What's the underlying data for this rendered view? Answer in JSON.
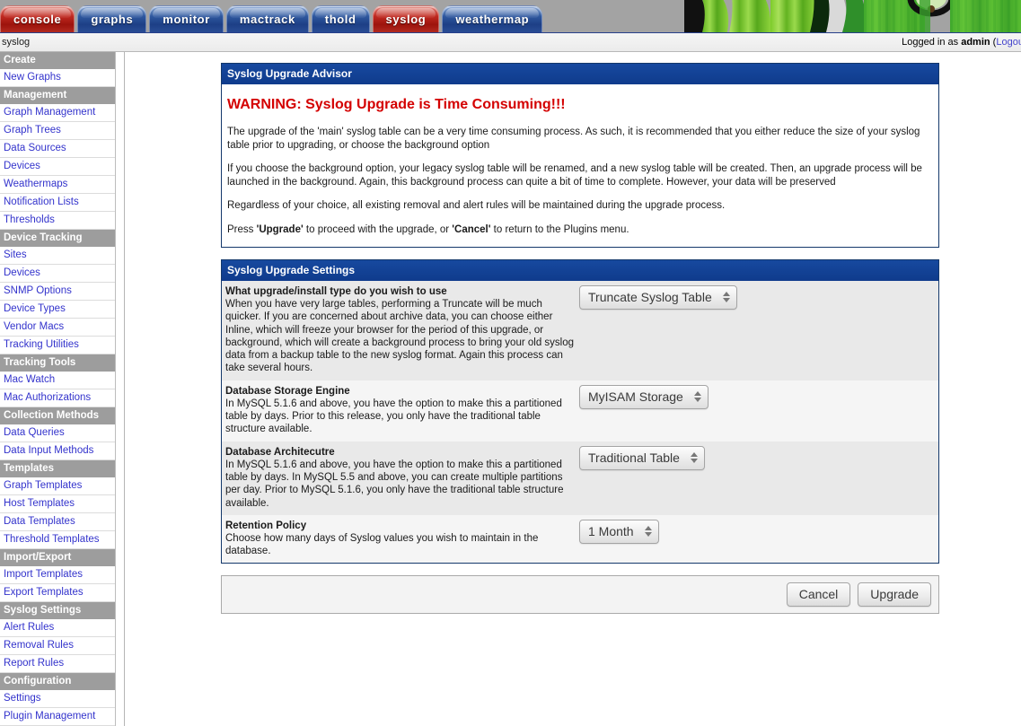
{
  "tabs": [
    {
      "label": "console",
      "state": "red"
    },
    {
      "label": "graphs",
      "state": "blue"
    },
    {
      "label": "monitor",
      "state": "blue"
    },
    {
      "label": "mactrack",
      "state": "blue"
    },
    {
      "label": "thold",
      "state": "blue"
    },
    {
      "label": "syslog",
      "state": "red"
    },
    {
      "label": "weathermap",
      "state": "blue"
    }
  ],
  "topbar": {
    "breadcrumb": "syslog",
    "logged_in_prefix": "Logged in as ",
    "user": "admin",
    "logout_open": " (",
    "logout_label": "Logout"
  },
  "sidebar": {
    "items": [
      {
        "label": "Create",
        "type": "header"
      },
      {
        "label": "New Graphs",
        "type": "link"
      },
      {
        "label": "Management",
        "type": "header"
      },
      {
        "label": "Graph Management",
        "type": "link"
      },
      {
        "label": "Graph Trees",
        "type": "link"
      },
      {
        "label": "Data Sources",
        "type": "link"
      },
      {
        "label": "Devices",
        "type": "link"
      },
      {
        "label": "Weathermaps",
        "type": "link"
      },
      {
        "label": "Notification Lists",
        "type": "link"
      },
      {
        "label": "Thresholds",
        "type": "link"
      },
      {
        "label": "Device Tracking",
        "type": "header"
      },
      {
        "label": "Sites",
        "type": "link"
      },
      {
        "label": "Devices",
        "type": "link"
      },
      {
        "label": "SNMP Options",
        "type": "link"
      },
      {
        "label": "Device Types",
        "type": "link"
      },
      {
        "label": "Vendor Macs",
        "type": "link"
      },
      {
        "label": "Tracking Utilities",
        "type": "link"
      },
      {
        "label": "Tracking Tools",
        "type": "header"
      },
      {
        "label": "Mac Watch",
        "type": "link"
      },
      {
        "label": "Mac Authorizations",
        "type": "link"
      },
      {
        "label": "Collection Methods",
        "type": "header"
      },
      {
        "label": "Data Queries",
        "type": "link"
      },
      {
        "label": "Data Input Methods",
        "type": "link"
      },
      {
        "label": "Templates",
        "type": "header"
      },
      {
        "label": "Graph Templates",
        "type": "link"
      },
      {
        "label": "Host Templates",
        "type": "link"
      },
      {
        "label": "Data Templates",
        "type": "link"
      },
      {
        "label": "Threshold Templates",
        "type": "link"
      },
      {
        "label": "Import/Export",
        "type": "header"
      },
      {
        "label": "Import Templates",
        "type": "link"
      },
      {
        "label": "Export Templates",
        "type": "link"
      },
      {
        "label": "Syslog Settings",
        "type": "header"
      },
      {
        "label": "Alert Rules",
        "type": "link"
      },
      {
        "label": "Removal Rules",
        "type": "link"
      },
      {
        "label": "Report Rules",
        "type": "link"
      },
      {
        "label": "Configuration",
        "type": "header"
      },
      {
        "label": "Settings",
        "type": "link"
      },
      {
        "label": "Plugin Management",
        "type": "link"
      }
    ]
  },
  "advisor": {
    "title": "Syslog Upgrade Advisor",
    "warning": "WARNING: Syslog Upgrade is Time Consuming!!!",
    "p1": "The upgrade of the 'main' syslog table can be a very time consuming process. As such, it is recommended that you either reduce the size of your syslog table prior to upgrading, or choose the background option",
    "p2": "If you choose the background option, your legacy syslog table will be renamed, and a new syslog table will be created. Then, an upgrade process will be launched in the background. Again, this background process can quite a bit of time to complete. However, your data will be preserved",
    "p3": "Regardless of your choice, all existing removal and alert rules will be maintained during the upgrade process.",
    "p4_a": "Press ",
    "p4_b": "'Upgrade'",
    "p4_c": " to proceed with the upgrade, or ",
    "p4_d": "'Cancel'",
    "p4_e": " to return to the Plugins menu."
  },
  "settings": {
    "title": "Syslog Upgrade Settings",
    "rows": [
      {
        "label": "What upgrade/install type do you wish to use",
        "desc": "When you have very large tables, performing a Truncate will be much quicker. If you are concerned about archive data, you can choose either Inline, which will freeze your browser for the period of this upgrade, or background, which will create a background process to bring your old syslog data from a backup table to the new syslog format. Again this process can take several hours.",
        "value": "Truncate Syslog Table"
      },
      {
        "label": "Database Storage Engine",
        "desc": "In MySQL 5.1.6 and above, you have the option to make this a partitioned table by days. Prior to this release, you only have the traditional table structure available.",
        "value": "MyISAM Storage"
      },
      {
        "label": "Database Architecutre",
        "desc": "In MySQL 5.1.6 and above, you have the option to make this a partitioned table by days. In MySQL 5.5 and above, you can create multiple partitions per day. Prior to MySQL 5.1.6, you only have the traditional table structure available.",
        "value": "Traditional Table"
      },
      {
        "label": "Retention Policy",
        "desc": "Choose how many days of Syslog values you wish to maintain in the database.",
        "value": "1 Month"
      }
    ]
  },
  "actions": {
    "cancel_label": "Cancel",
    "upgrade_label": "Upgrade"
  },
  "colors": {
    "panel_header": "#10439c",
    "warning_red": "#d40000",
    "nav_header_bg": "#9d9d9d",
    "nav_link": "#3333cc",
    "tab_red": "#c02a21",
    "tab_blue": "#2f589f"
  }
}
